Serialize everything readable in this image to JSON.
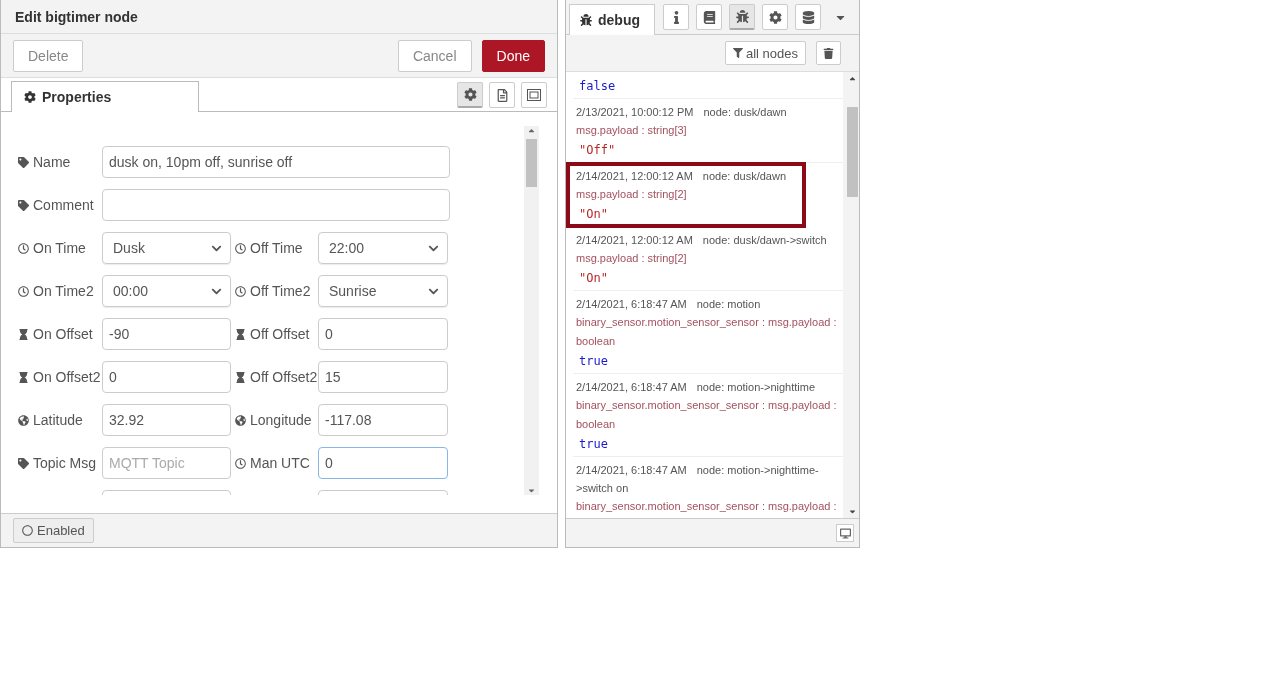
{
  "editor": {
    "title": "Edit bigtimer node",
    "buttons": [
      {
        "label": "Delete",
        "kind": "plain"
      },
      {
        "label": "Cancel",
        "kind": "plain"
      },
      {
        "label": "Done",
        "kind": "primary"
      }
    ],
    "tab": {
      "label": "Properties",
      "selected": true
    },
    "tool_buttons": [
      {
        "kind": "gear",
        "selected": true
      },
      {
        "kind": "document",
        "selected": false
      },
      {
        "kind": "frame",
        "selected": false
      }
    ],
    "rows": [
      {
        "kind": "wide",
        "label": {
          "text": "Name",
          "kind": "tag"
        },
        "value": "dusk on, 10pm off, sunrise off"
      },
      {
        "kind": "wide",
        "label": {
          "text": "Comment",
          "kind": "tag"
        }
      },
      {
        "kind": "pair",
        "fields": [
          {
            "label": {
              "text": "On Time",
              "kind": "clock"
            },
            "kind": "select",
            "value": "Dusk"
          },
          {
            "label": {
              "text": "Off Time",
              "kind": "clock"
            },
            "kind": "select",
            "value": "22:00"
          }
        ]
      },
      {
        "kind": "pair",
        "fields": [
          {
            "label": {
              "text": "On Time2",
              "kind": "clock"
            },
            "kind": "select",
            "value": "00:00"
          },
          {
            "label": {
              "text": "Off Time2",
              "kind": "clock"
            },
            "kind": "select",
            "value": "Sunrise"
          }
        ]
      },
      {
        "kind": "pair",
        "fields": [
          {
            "label": {
              "text": "On Offset",
              "kind": "hourglass"
            },
            "kind": "input",
            "value": "-90"
          },
          {
            "label": {
              "text": "Off Offset",
              "kind": "hourglass"
            },
            "kind": "input",
            "value": "0"
          }
        ]
      },
      {
        "kind": "pair",
        "fields": [
          {
            "label": {
              "text": "On Offset2",
              "kind": "hourglass"
            },
            "kind": "input",
            "value": "0"
          },
          {
            "label": {
              "text": "Off Offset2",
              "kind": "hourglass"
            },
            "kind": "input",
            "value": "15"
          }
        ]
      },
      {
        "kind": "pair",
        "fields": [
          {
            "label": {
              "text": "Latitude",
              "kind": "globe"
            },
            "kind": "input",
            "value": "32.92"
          },
          {
            "label": {
              "text": "Longitude",
              "kind": "globe"
            },
            "kind": "input",
            "value": "-117.08"
          }
        ]
      },
      {
        "kind": "pair",
        "fields": [
          {
            "label": {
              "text": "Topic Msg",
              "kind": "tag"
            },
            "kind": "input",
            "placeholder": "MQTT Topic"
          },
          {
            "label": {
              "text": "Man UTC",
              "kind": "clock"
            },
            "kind": "input",
            "value": "0",
            "focused": true
          }
        ]
      },
      {
        "kind": "pair",
        "fields": [
          {
            "kind": "input"
          },
          {
            "kind": "input"
          }
        ]
      }
    ],
    "enabled_toggle": {
      "label": "Enabled"
    }
  },
  "sidebar": {
    "tab": {
      "label": "debug",
      "selected": true
    },
    "tool_buttons": [
      {
        "kind": "info",
        "selected": false
      },
      {
        "kind": "book",
        "selected": false
      },
      {
        "kind": "bug",
        "selected": true
      },
      {
        "kind": "gear",
        "selected": false
      },
      {
        "kind": "database",
        "selected": false
      }
    ],
    "filter_button": "all nodes",
    "messages": [
      {
        "value": "false",
        "kind": "boolean",
        "highlighted": false
      },
      {
        "time": "2/13/2021, 10:00:12 PM",
        "node": "node: dusk/dawn",
        "meta": "msg.payload : string[3]",
        "value": "\"Off\"",
        "kind": "string",
        "highlighted": false
      },
      {
        "time": "2/14/2021, 12:00:12 AM",
        "node": "node: dusk/dawn",
        "meta": "msg.payload : string[2]",
        "value": "\"On\"",
        "kind": "string",
        "highlighted": true
      },
      {
        "time": "2/14/2021, 12:00:12 AM",
        "node": "node: dusk/dawn->switch",
        "meta": "msg.payload : string[2]",
        "value": "\"On\"",
        "kind": "string",
        "highlighted": false
      },
      {
        "time": "2/14/2021, 6:18:47 AM",
        "node": "node: motion",
        "meta": "binary_sensor.motion_sensor_sensor : msg.payload : boolean",
        "value": "true",
        "kind": "boolean",
        "highlighted": false
      },
      {
        "time": "2/14/2021, 6:18:47 AM",
        "node": "node: motion->nighttime",
        "meta": "binary_sensor.motion_sensor_sensor : msg.payload : boolean",
        "value": "true",
        "kind": "boolean",
        "highlighted": false
      },
      {
        "time": "2/14/2021, 6:18:47 AM",
        "node": "node: motion->nighttime->switch on",
        "meta": "binary_sensor.motion_sensor_sensor : msg.payload :",
        "highlighted": false
      }
    ]
  }
}
